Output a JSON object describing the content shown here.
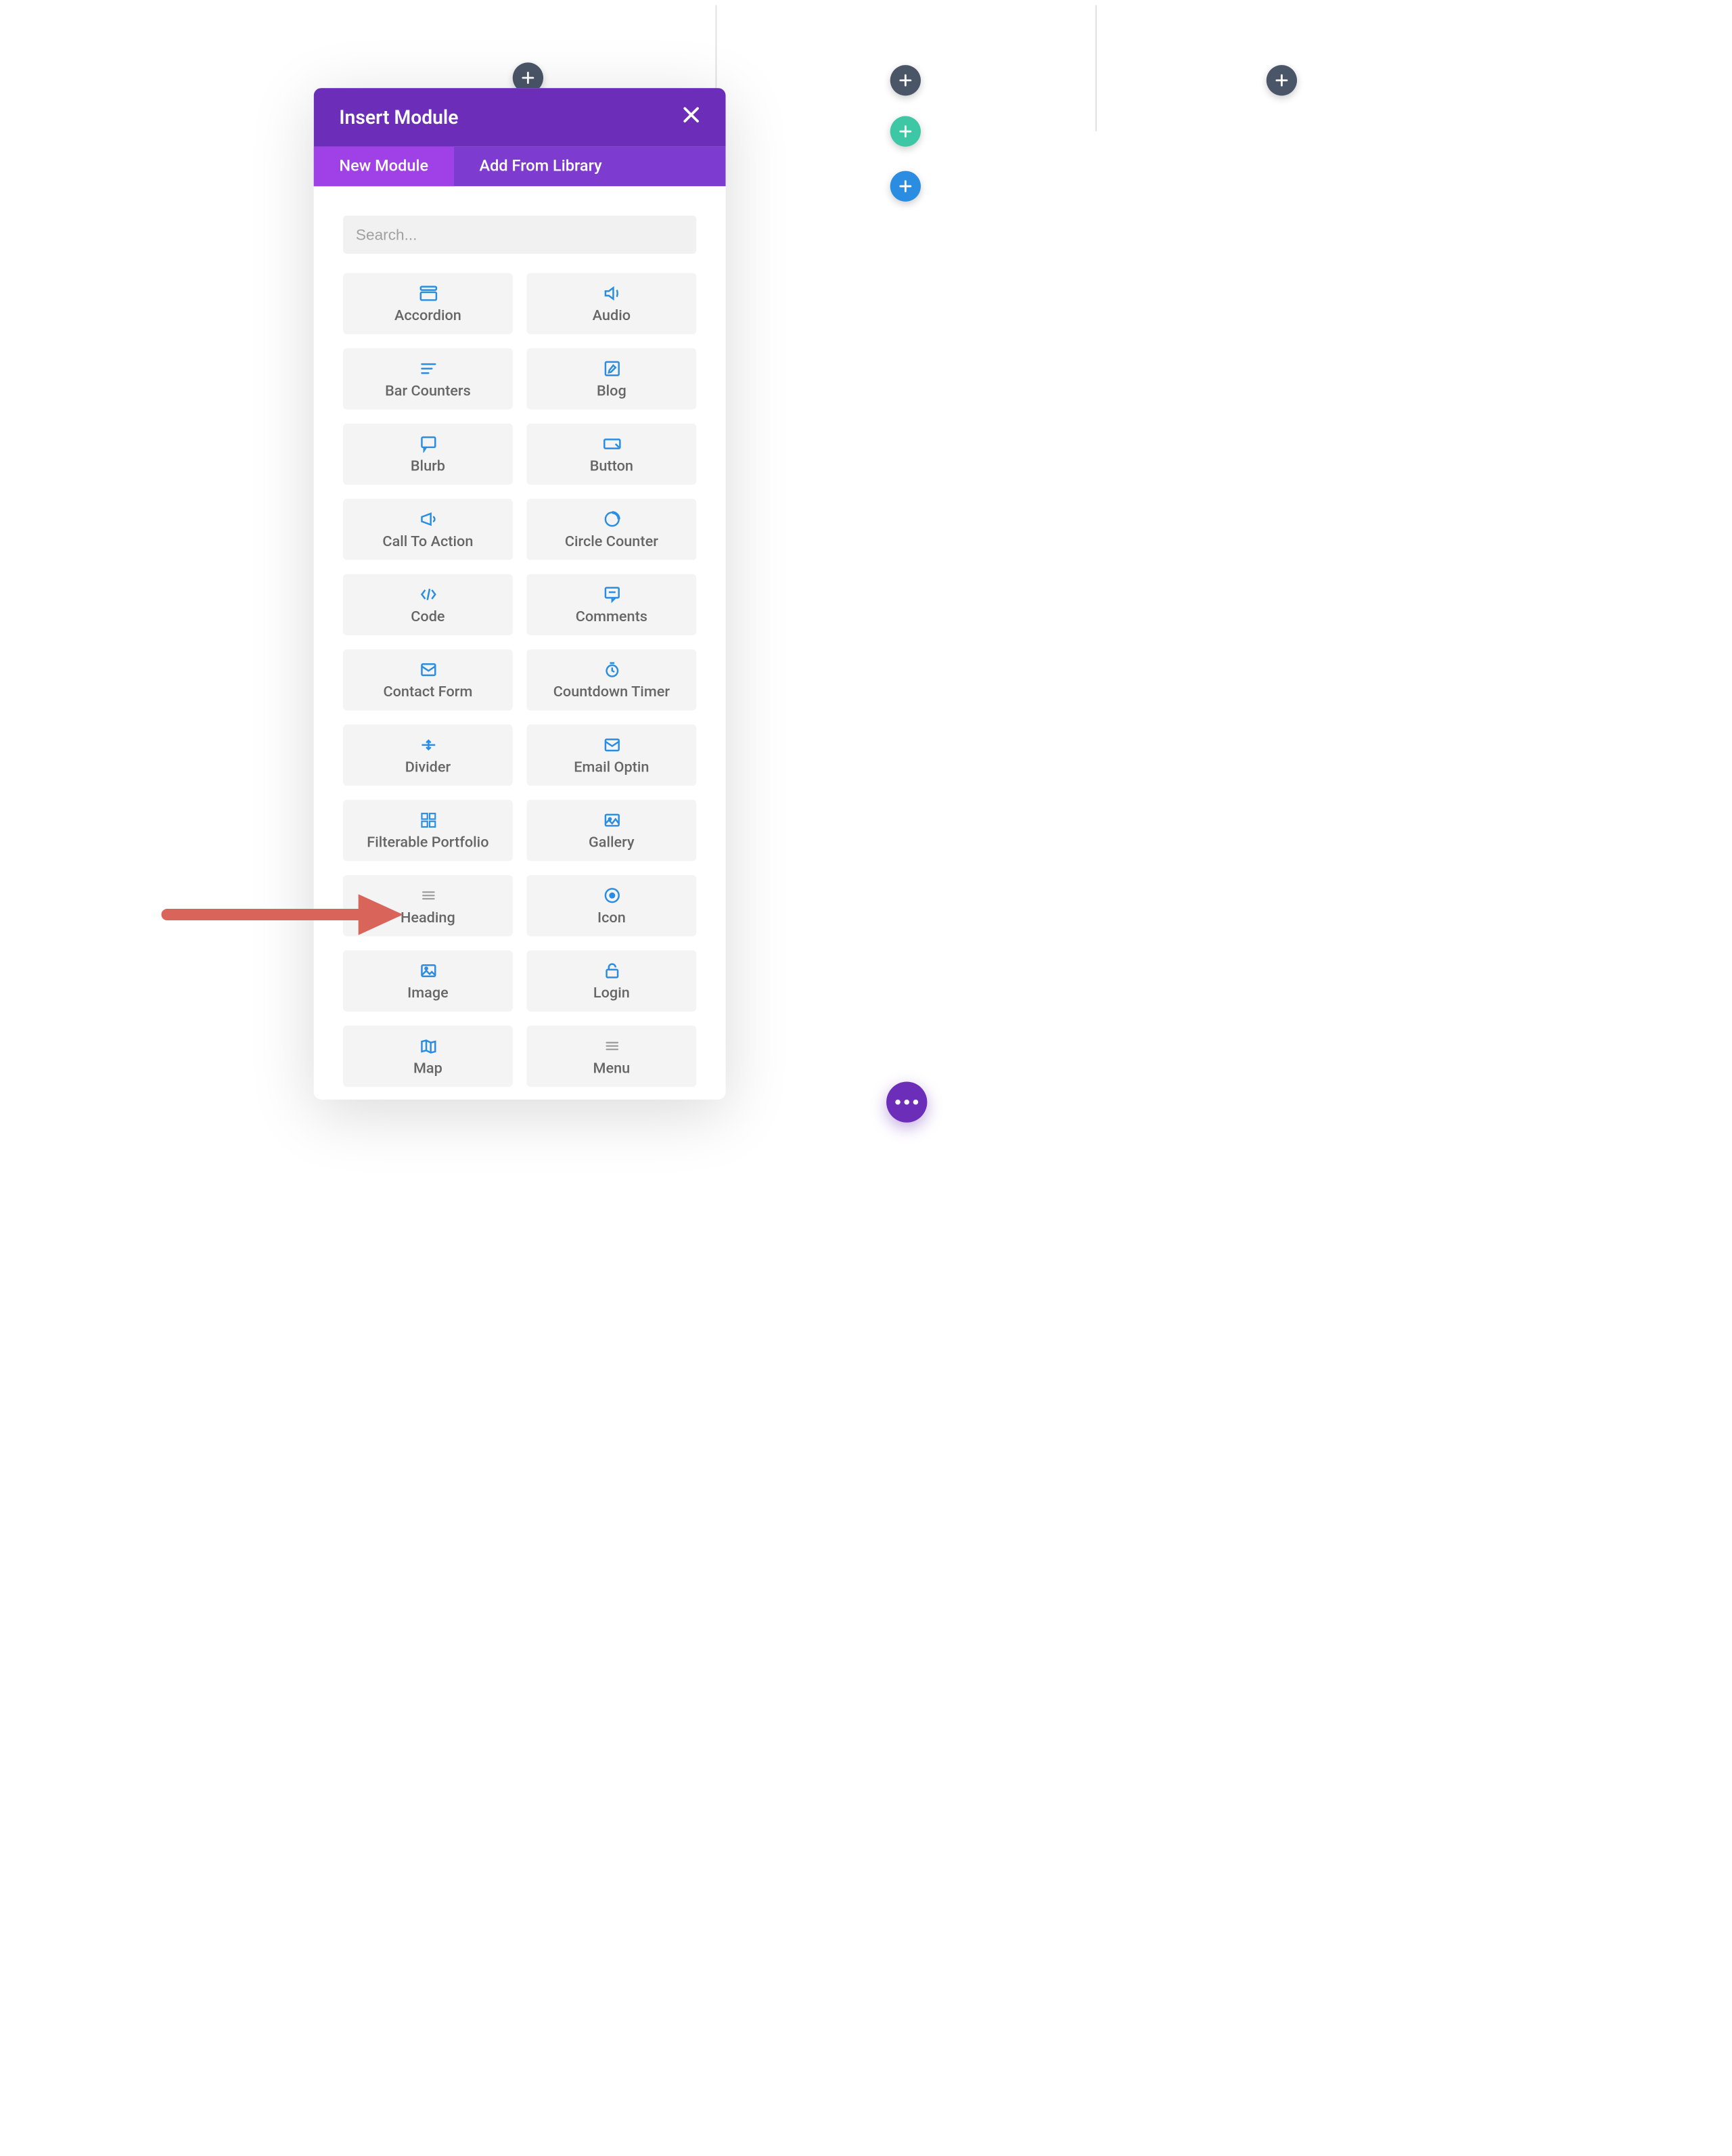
{
  "modal": {
    "title": "Insert Module",
    "tabs": [
      {
        "label": "New Module",
        "active": true
      },
      {
        "label": "Add From Library",
        "active": false
      }
    ],
    "search": {
      "placeholder": "Search..."
    }
  },
  "modules": [
    {
      "id": "accordion",
      "label": "Accordion",
      "icon": "accordion"
    },
    {
      "id": "audio",
      "label": "Audio",
      "icon": "audio"
    },
    {
      "id": "bar-counters",
      "label": "Bar Counters",
      "icon": "bars"
    },
    {
      "id": "blog",
      "label": "Blog",
      "icon": "edit"
    },
    {
      "id": "blurb",
      "label": "Blurb",
      "icon": "chat"
    },
    {
      "id": "button",
      "label": "Button",
      "icon": "button"
    },
    {
      "id": "call-to-action",
      "label": "Call To Action",
      "icon": "megaphone"
    },
    {
      "id": "circle-counter",
      "label": "Circle Counter",
      "icon": "circle"
    },
    {
      "id": "code",
      "label": "Code",
      "icon": "code"
    },
    {
      "id": "comments",
      "label": "Comments",
      "icon": "comment"
    },
    {
      "id": "contact-form",
      "label": "Contact Form",
      "icon": "mail"
    },
    {
      "id": "countdown-timer",
      "label": "Countdown Timer",
      "icon": "timer"
    },
    {
      "id": "divider",
      "label": "Divider",
      "icon": "divider"
    },
    {
      "id": "email-optin",
      "label": "Email Optin",
      "icon": "mail"
    },
    {
      "id": "filterable-portfolio",
      "label": "Filterable Portfolio",
      "icon": "grid"
    },
    {
      "id": "gallery",
      "label": "Gallery",
      "icon": "gallery"
    },
    {
      "id": "heading",
      "label": "Heading",
      "icon": "heading",
      "gray": true
    },
    {
      "id": "icon",
      "label": "Icon",
      "icon": "target"
    },
    {
      "id": "image",
      "label": "Image",
      "icon": "image"
    },
    {
      "id": "login",
      "label": "Login",
      "icon": "lock"
    },
    {
      "id": "map",
      "label": "Map",
      "icon": "map"
    },
    {
      "id": "menu",
      "label": "Menu",
      "icon": "menu",
      "gray": true
    }
  ],
  "colors": {
    "purple": "#6c2eb9",
    "purple_light": "#a041e8",
    "blue_icon": "#2a8de2",
    "teal": "#3ec7a4",
    "dark": "#4a5568",
    "arrow": "#d96459"
  }
}
